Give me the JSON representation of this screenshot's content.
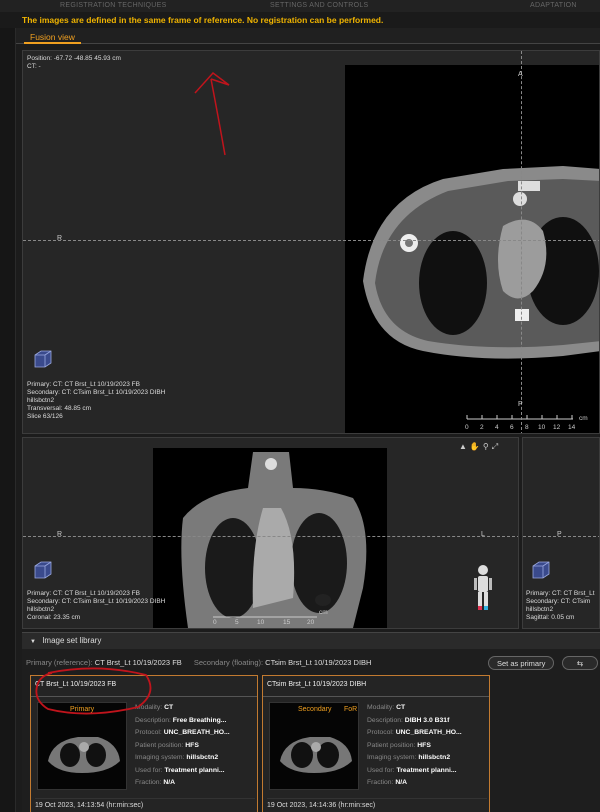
{
  "topnav": {
    "left": "REGISTRATION TECHNIQUES",
    "mid": "SETTINGS AND CONTROLS",
    "right": "ADAPTATION"
  },
  "warning": "The images are defined in the same frame of reference. No registration can be performed.",
  "tab": "Fusion view",
  "axial": {
    "position": "Position: -67.72 -48.85 45.93 cm",
    "ct": "CT: -",
    "marker_top": "A",
    "marker_left": "R",
    "marker_bottom": "P",
    "primary": "Primary: CT: CT Brst_Lt 10/19/2023 FB",
    "secondary": "Secondary: CT: CTsim Brst_Lt 10/19/2023 DIBH",
    "user": "hillsbctn2",
    "plane": "Transversal: 48.85 cm",
    "slice": "Slice 63/126",
    "scale_labels": [
      "0",
      "2",
      "4",
      "6",
      "8",
      "10",
      "12",
      "14"
    ],
    "scale_unit": "cm"
  },
  "coronal": {
    "marker_left": "R",
    "marker_right": "L",
    "primary": "Primary: CT: CT Brst_Lt 10/19/2023 FB",
    "secondary": "Secondary: CT: CTsim Brst_Lt 10/19/2023 DIBH",
    "user": "hillsbctn2",
    "plane": "Coronal: 23.35 cm",
    "scale_labels": [
      "0",
      "5",
      "10",
      "15",
      "20"
    ],
    "scale_unit": "cm"
  },
  "sagittal": {
    "marker": "P",
    "primary": "Primary: CT: CT Brst_Lt",
    "secondary": "Secondary: CT: CTsim",
    "user": "hillsbctn2",
    "plane": "Sagittal: 0.05 cm"
  },
  "library": {
    "header": "Image set library",
    "primary_label": "Primary (reference):",
    "primary_value": "CT Brst_Lt 10/19/2023 FB",
    "secondary_label": "Secondary (floating):",
    "secondary_value": "CTsim Brst_Lt 10/19/2023 DIBH",
    "set_primary_btn": "Set as primary",
    "swap_icon": "swap-arrows-icon",
    "cards": [
      {
        "title": "CT Brst_Lt 10/19/2023 FB",
        "badge": "Primary",
        "badge2": "",
        "props": [
          [
            "Modality:",
            "CT"
          ],
          [
            "Description:",
            "Free Breathing..."
          ],
          [
            "Protocol:",
            "UNC_BREATH_HO..."
          ],
          [
            "Patient position:",
            "HFS"
          ],
          [
            "Imaging system:",
            "hillsbctn2"
          ],
          [
            "Used for:",
            "Treatment planni..."
          ],
          [
            "Fraction:",
            "N/A"
          ]
        ],
        "date": "19 Oct 2023, 14:13:54 (hr:min:sec)"
      },
      {
        "title": "CTsim Brst_Lt 10/19/2023 DIBH",
        "badge": "Secondary",
        "badge2": "FoR",
        "props": [
          [
            "Modality:",
            "CT"
          ],
          [
            "Description:",
            "DIBH 3.0 B31f"
          ],
          [
            "Protocol:",
            "UNC_BREATH_HO..."
          ],
          [
            "Patient position:",
            "HFS"
          ],
          [
            "Imaging system:",
            "hillsbctn2"
          ],
          [
            "Used for:",
            "Treatment planni..."
          ],
          [
            "Fraction:",
            "N/A"
          ]
        ],
        "date": "19 Oct 2023, 14:14:36 (hr:min:sec)"
      }
    ]
  },
  "colors": {
    "accent": "#f0a020",
    "warning": "#f0b400",
    "annotation": "#c0141c"
  }
}
